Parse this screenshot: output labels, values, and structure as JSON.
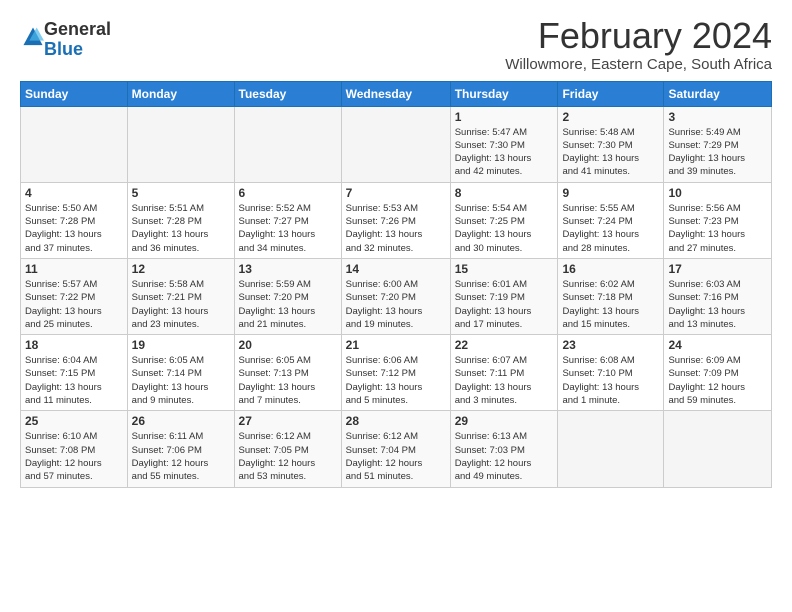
{
  "logo": {
    "general": "General",
    "blue": "Blue"
  },
  "title": "February 2024",
  "subtitle": "Willowmore, Eastern Cape, South Africa",
  "days_of_week": [
    "Sunday",
    "Monday",
    "Tuesday",
    "Wednesday",
    "Thursday",
    "Friday",
    "Saturday"
  ],
  "weeks": [
    [
      {
        "day": "",
        "info": ""
      },
      {
        "day": "",
        "info": ""
      },
      {
        "day": "",
        "info": ""
      },
      {
        "day": "",
        "info": ""
      },
      {
        "day": "1",
        "info": "Sunrise: 5:47 AM\nSunset: 7:30 PM\nDaylight: 13 hours\nand 42 minutes."
      },
      {
        "day": "2",
        "info": "Sunrise: 5:48 AM\nSunset: 7:30 PM\nDaylight: 13 hours\nand 41 minutes."
      },
      {
        "day": "3",
        "info": "Sunrise: 5:49 AM\nSunset: 7:29 PM\nDaylight: 13 hours\nand 39 minutes."
      }
    ],
    [
      {
        "day": "4",
        "info": "Sunrise: 5:50 AM\nSunset: 7:28 PM\nDaylight: 13 hours\nand 37 minutes."
      },
      {
        "day": "5",
        "info": "Sunrise: 5:51 AM\nSunset: 7:28 PM\nDaylight: 13 hours\nand 36 minutes."
      },
      {
        "day": "6",
        "info": "Sunrise: 5:52 AM\nSunset: 7:27 PM\nDaylight: 13 hours\nand 34 minutes."
      },
      {
        "day": "7",
        "info": "Sunrise: 5:53 AM\nSunset: 7:26 PM\nDaylight: 13 hours\nand 32 minutes."
      },
      {
        "day": "8",
        "info": "Sunrise: 5:54 AM\nSunset: 7:25 PM\nDaylight: 13 hours\nand 30 minutes."
      },
      {
        "day": "9",
        "info": "Sunrise: 5:55 AM\nSunset: 7:24 PM\nDaylight: 13 hours\nand 28 minutes."
      },
      {
        "day": "10",
        "info": "Sunrise: 5:56 AM\nSunset: 7:23 PM\nDaylight: 13 hours\nand 27 minutes."
      }
    ],
    [
      {
        "day": "11",
        "info": "Sunrise: 5:57 AM\nSunset: 7:22 PM\nDaylight: 13 hours\nand 25 minutes."
      },
      {
        "day": "12",
        "info": "Sunrise: 5:58 AM\nSunset: 7:21 PM\nDaylight: 13 hours\nand 23 minutes."
      },
      {
        "day": "13",
        "info": "Sunrise: 5:59 AM\nSunset: 7:20 PM\nDaylight: 13 hours\nand 21 minutes."
      },
      {
        "day": "14",
        "info": "Sunrise: 6:00 AM\nSunset: 7:20 PM\nDaylight: 13 hours\nand 19 minutes."
      },
      {
        "day": "15",
        "info": "Sunrise: 6:01 AM\nSunset: 7:19 PM\nDaylight: 13 hours\nand 17 minutes."
      },
      {
        "day": "16",
        "info": "Sunrise: 6:02 AM\nSunset: 7:18 PM\nDaylight: 13 hours\nand 15 minutes."
      },
      {
        "day": "17",
        "info": "Sunrise: 6:03 AM\nSunset: 7:16 PM\nDaylight: 13 hours\nand 13 minutes."
      }
    ],
    [
      {
        "day": "18",
        "info": "Sunrise: 6:04 AM\nSunset: 7:15 PM\nDaylight: 13 hours\nand 11 minutes."
      },
      {
        "day": "19",
        "info": "Sunrise: 6:05 AM\nSunset: 7:14 PM\nDaylight: 13 hours\nand 9 minutes."
      },
      {
        "day": "20",
        "info": "Sunrise: 6:05 AM\nSunset: 7:13 PM\nDaylight: 13 hours\nand 7 minutes."
      },
      {
        "day": "21",
        "info": "Sunrise: 6:06 AM\nSunset: 7:12 PM\nDaylight: 13 hours\nand 5 minutes."
      },
      {
        "day": "22",
        "info": "Sunrise: 6:07 AM\nSunset: 7:11 PM\nDaylight: 13 hours\nand 3 minutes."
      },
      {
        "day": "23",
        "info": "Sunrise: 6:08 AM\nSunset: 7:10 PM\nDaylight: 13 hours\nand 1 minute."
      },
      {
        "day": "24",
        "info": "Sunrise: 6:09 AM\nSunset: 7:09 PM\nDaylight: 12 hours\nand 59 minutes."
      }
    ],
    [
      {
        "day": "25",
        "info": "Sunrise: 6:10 AM\nSunset: 7:08 PM\nDaylight: 12 hours\nand 57 minutes."
      },
      {
        "day": "26",
        "info": "Sunrise: 6:11 AM\nSunset: 7:06 PM\nDaylight: 12 hours\nand 55 minutes."
      },
      {
        "day": "27",
        "info": "Sunrise: 6:12 AM\nSunset: 7:05 PM\nDaylight: 12 hours\nand 53 minutes."
      },
      {
        "day": "28",
        "info": "Sunrise: 6:12 AM\nSunset: 7:04 PM\nDaylight: 12 hours\nand 51 minutes."
      },
      {
        "day": "29",
        "info": "Sunrise: 6:13 AM\nSunset: 7:03 PM\nDaylight: 12 hours\nand 49 minutes."
      },
      {
        "day": "",
        "info": ""
      },
      {
        "day": "",
        "info": ""
      }
    ]
  ]
}
